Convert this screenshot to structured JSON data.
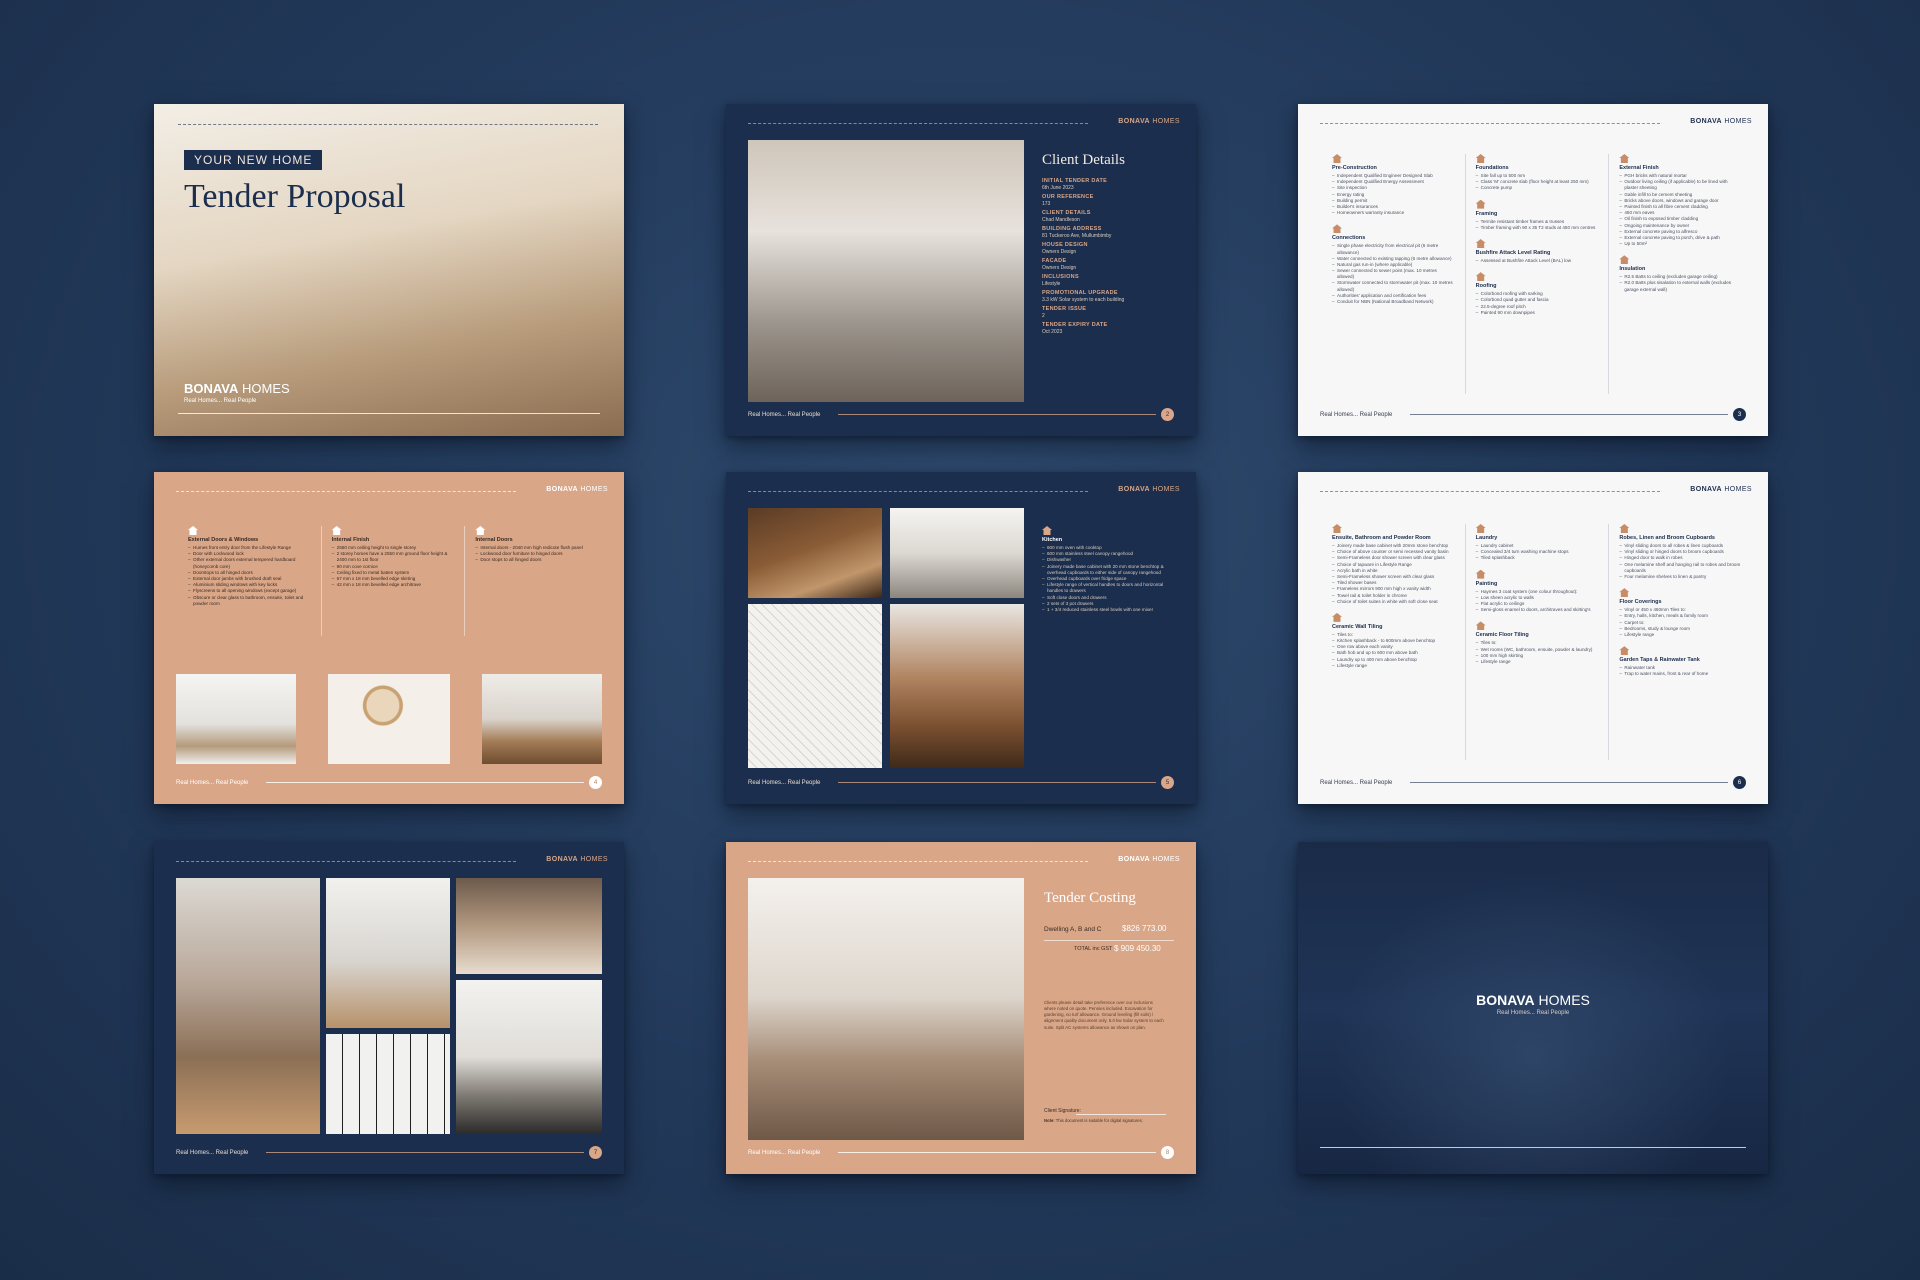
{
  "brand": {
    "name_bold": "BONAVA",
    "name_light": " HOMES",
    "tagline": "Real Homes... Real People"
  },
  "slide1": {
    "badge": "YOUR NEW HOME",
    "title": "Tender Proposal"
  },
  "slide2": {
    "title": "Client Details",
    "page": "2",
    "details": [
      {
        "label": "INITIAL TENDER DATE",
        "value": "6th June 2023"
      },
      {
        "label": "OUR REFERENCE",
        "value": "173"
      },
      {
        "label": "CLIENT DETAILS",
        "value": "Chad Mandleson"
      },
      {
        "label": "BUILDING ADDRESS",
        "value": "81 Tuckeroo Ave, Mullumbimby"
      },
      {
        "label": "HOUSE DESIGN",
        "value": "Owners Design"
      },
      {
        "label": "FACADE",
        "value": "Owners Design"
      },
      {
        "label": "INCLUSIONS",
        "value": "Lifestyle"
      },
      {
        "label": "PROMOTIONAL UPGRADE",
        "value": "3.3 kW Solar system to each building"
      },
      {
        "label": "TENDER ISSUE",
        "value": "2"
      },
      {
        "label": "TENDER EXPIRY DATE",
        "value": "Oct 2023"
      }
    ]
  },
  "slide3": {
    "page": "3",
    "columns": [
      [
        {
          "title": "Pre-Construction",
          "items": [
            "Independent Qualified Engineer Designed Slab",
            "Independent Qualified Energy Assessment",
            "Site inspection",
            "Energy rating",
            "Building permit",
            "Builder's insurances",
            "Homeowners warranty insurance"
          ]
        },
        {
          "title": "Connections",
          "items": [
            "Single phase electricity from electrical pit (6 metre allowance)",
            "Water connected to existing tapping (6 metre allowance)",
            "Natural gas run-in (where applicable)",
            "Sewer connected to sewer point (max. 10 metres allowed)",
            "Stormwater connected to stormwater pit (max. 10 metres allowed)",
            "Authorities' application and certification fees",
            "Conduit for NBN (National Broadband Network)"
          ]
        }
      ],
      [
        {
          "title": "Foundations",
          "items": [
            "Site fall up to 500 mm",
            "Class 'M' concrete slab (floor height at least 250 mm)",
            "Concrete pump"
          ]
        },
        {
          "title": "Framing",
          "items": [
            "Termite resistant timber frames & trusses",
            "Timber framing with 90 x 35 T2 studs at 450 mm centres"
          ]
        },
        {
          "title": "Bushfire Attack Level Rating",
          "items": [
            "Assessed at Bushfire Attack Level (BAL) low"
          ]
        },
        {
          "title": "Roofing",
          "items": [
            "Colorbond roofing with sarking",
            "Colorbond quad gutter and fascia",
            "22.5-degree roof pitch",
            "Painted 90 mm downpipes"
          ]
        }
      ],
      [
        {
          "title": "External Finish",
          "items": [
            "PGH bricks with natural mortar",
            "Outdoor living ceiling (if applicable) to be lined with plaster sheeting",
            "Gable infill to be cement sheeting",
            "Bricks above doors, windows and garage door",
            "Painted finish to all fibre cement cladding",
            "450 mm eaves",
            "Oil finish to exposed timber cladding",
            "Ongoing maintenance by owner",
            "External concrete paving to alfresco",
            "External concrete paving to porch, drive & path",
            "Up to 50m²"
          ]
        },
        {
          "title": "Insulation",
          "items": [
            "R2.5 Batts to ceiling (excludes garage ceiling)",
            "R2.0 Batts plus sisalation to external walls (excludes garage external wall)"
          ]
        }
      ]
    ]
  },
  "slide4": {
    "page": "4",
    "columns": [
      {
        "title": "External Doors & Windows",
        "items": [
          "Humes front entry door from the Lifestyle Range",
          "Door with Lockwood lock",
          "Other external doors external tempered hardboard (honeycomb core)",
          "Doorstops to all hinged doors",
          "External door jambs with brushed draft seal",
          "Aluminium sliding windows with key locks",
          "Flyscreens to all opening windows (except garage)",
          "Obscure or clear glass to bathroom, ensuite, toilet and powder room"
        ]
      },
      {
        "title": "Internal Finish",
        "items": [
          "2550 mm ceiling height to single storey",
          "2 storey homes have a 2550 mm ground floor height & 2400 mm to 1st floor",
          "90 mm cove cornice",
          "Ceiling fixed to metal batten system",
          "67 mm x 18 mm bevelled edge skirting",
          "42 mm x 18 mm bevelled edge architrave"
        ]
      },
      {
        "title": "Internal Doors",
        "items": [
          "Internal doors - 2040 mm high redicote flush panel",
          "Lockwood door furniture to hinged doors",
          "Door stops to all hinged doors"
        ]
      }
    ]
  },
  "slide5": {
    "page": "5",
    "title": "Kitchen",
    "items": [
      "600 mm oven with cooktop",
      "600 mm stainless steel canopy rangehood",
      "Dishwasher",
      "Joinery made base cabinet with 20 mm stone benchtop & overhead cupboards to either side of canopy rangehood",
      "Overhead cupboards over fridge space",
      "Lifestyle range of vertical handles to doors and horizontal handles to drawers",
      "Soft close doors and drawers",
      "2 sets of 3 pot drawers",
      "1 + 3/4 reduced stainless steel bowls with one mixer"
    ]
  },
  "slide6": {
    "page": "6",
    "columns": [
      [
        {
          "title": "Ensuite, Bathroom and Powder Room",
          "items": [
            "Joinery made base cabinet with 20mm stone benchtop",
            "Choice of above counter or semi recessed vanity basin",
            "Semi-Frameless door shower screen with clear glass",
            "Choice of tapware in Lifestyle Range",
            "Acrylic bath in white",
            "Semi-Frameless shower screen with clear glass",
            "Tiled shower bases",
            "Frameless mirrors 900 mm high x vanity width",
            "Towel rail & toilet holder in chrome",
            "Choice of toilet suites in white with soft close seat"
          ]
        },
        {
          "title": "Ceramic Wall Tiling",
          "items": [
            "Tiles to:",
            "Kitchen splashback - to 600mm above benchtop",
            "One row above each vanity",
            "Bath hob and up to 600 mm above bath",
            "Laundry up to 400 mm above benchtop",
            "Lifestyle range"
          ]
        }
      ],
      [
        {
          "title": "Laundry",
          "items": [
            "Laundry cabinet",
            "Concealed 3/4 turn washing machine stops",
            "Tiled splashback"
          ]
        },
        {
          "title": "Painting",
          "items": [
            "Haymes 3 coat system (one colour throughout):",
            "Low sheen acrylic to walls",
            "Flat acrylic to ceilings",
            "Semi-gloss enamel to doors, architraves and skirting's"
          ]
        },
        {
          "title": "Ceramic Floor Tiling",
          "items": [
            "Tiles to:",
            "Wet rooms (WC, bathroom, ensuite, powder & laundry)",
            "100 mm high skirting",
            "Lifestyle range"
          ]
        }
      ],
      [
        {
          "title": "Robes, Linen and Broom Cupboards",
          "items": [
            "Vinyl sliding doors to all robes & linen cupboards",
            "Vinyl sliding or hinged doors to broom cupboards",
            "Hinged door to walk in robes",
            "One melamine shelf and hanging rail to robes and broom cupboards",
            "Four melamine shelves to linen & pantry"
          ]
        },
        {
          "title": "Floor Coverings",
          "items": [
            "Vinyl or 450 x 450mm Tiles to:",
            "Entry, halls, kitchen, meals & family room",
            "Carpet to:",
            "Bedrooms, study & lounge room",
            "Lifestyle range"
          ]
        },
        {
          "title": "Garden Taps & Rainwater Tank",
          "items": [
            "Rainwater tank",
            "Trap to water mains, front & rear of home"
          ]
        }
      ]
    ]
  },
  "slide7": {
    "page": "7"
  },
  "slide8": {
    "page": "8",
    "title": "Tender Costing",
    "dwelling_label": "Dwelling A, B and C",
    "dwelling_amount": "$826 773.00",
    "total_label": "TOTAL inc GST",
    "total_amount": "$ 909 450.30",
    "notes": "Clients please detail take preference over our inclusions where noted on quote. Pennies included. Excavation for gardening, no turf allowance. Ground leveling (fill soils) / alignment quality document only. 5.0 kw Solar system to each suite. Split AC systems allowance as shown on plan.",
    "signature_label": "Client Signature:",
    "note_label": "Note:",
    "note_text": "This document is suitable for digital signatures."
  },
  "colors": {
    "navy": "#1c2e4d",
    "peach": "#d9a688",
    "white": "#f7f7f8",
    "background": "#22395a"
  }
}
